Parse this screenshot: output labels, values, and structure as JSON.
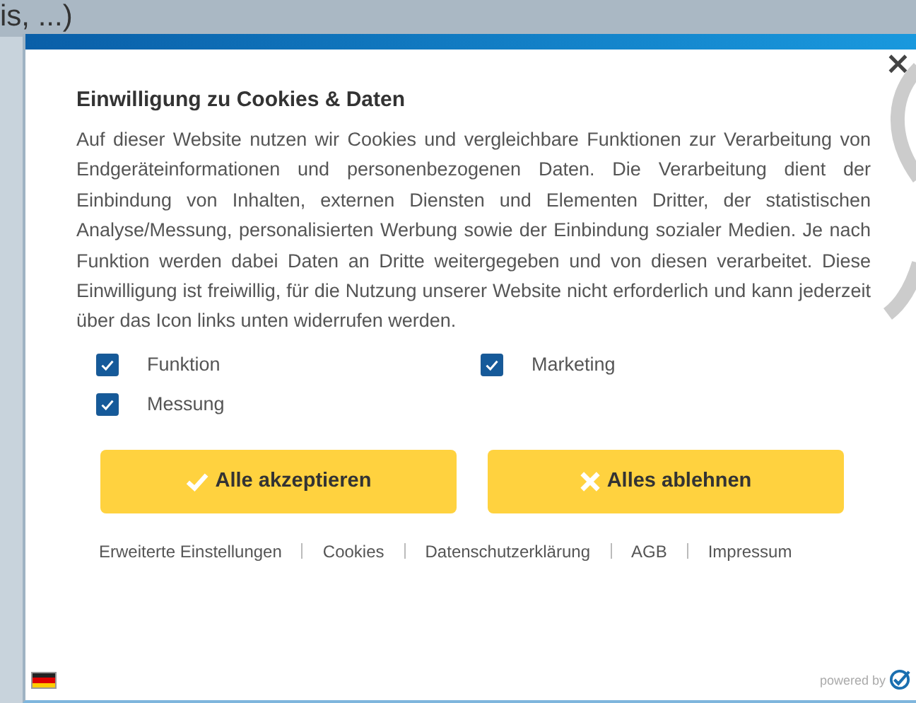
{
  "page_text": "is, ...)",
  "dialog": {
    "close": "×",
    "title": "Einwilligung zu Cookies & Daten",
    "text": "Auf dieser Website nutzen wir Cookies und vergleichbare Funktionen zur Verarbeitung von Endgeräteinformationen und personenbezogenen Daten. Die Verarbeitung dient der Einbindung von Inhalten, externen Diensten und Elementen Dritter, der statistischen Analyse/Messung, personalisierten Werbung sowie der Einbindung sozialer Medien. Je nach Funktion werden dabei Daten an Dritte weitergegeben und von diesen verarbeitet. Diese Einwilligung ist freiwillig, für die Nutzung unserer Website nicht erforderlich und kann jederzeit über das Icon links unten widerrufen werden.",
    "options": [
      {
        "label": "Funktion",
        "checked": true
      },
      {
        "label": "Marketing",
        "checked": true
      },
      {
        "label": "Messung",
        "checked": true
      }
    ],
    "buttons": [
      {
        "label": "Alle akzeptieren",
        "kind": "accept"
      },
      {
        "label": "Alles ablehnen",
        "kind": "reject"
      }
    ],
    "links": [
      "Erweiterte Einstellungen",
      "Cookies",
      "Datenschutzerklärung",
      "AGB",
      "Impressum"
    ],
    "powered_by": "powered by"
  }
}
